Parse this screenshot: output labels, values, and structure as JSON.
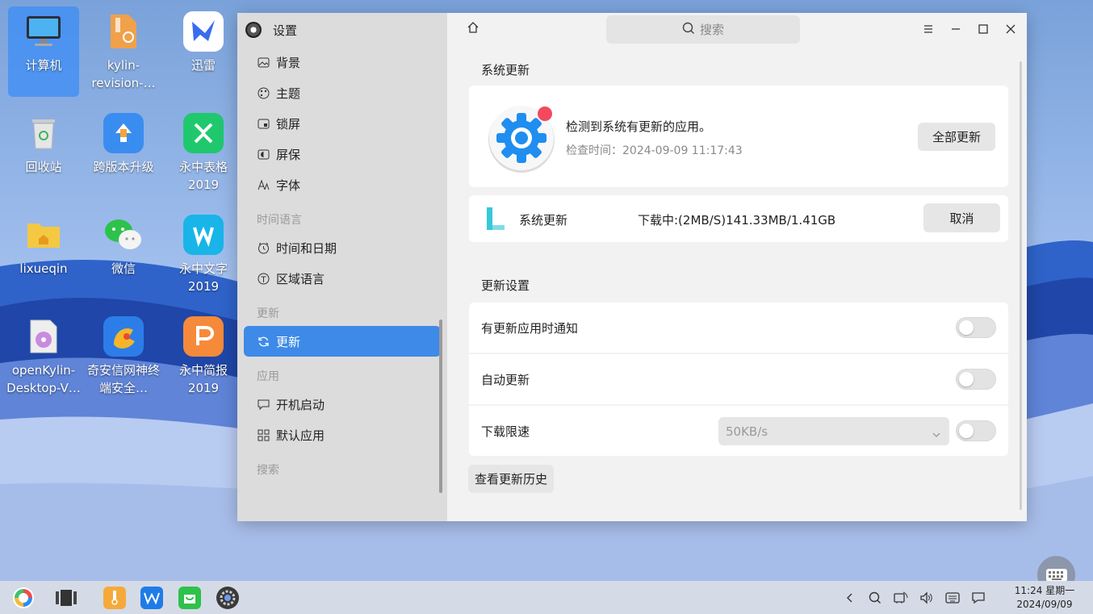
{
  "desktop": {
    "icons": [
      {
        "label": "计算机"
      },
      {
        "label": "kylin-revision-…"
      },
      {
        "label": "迅雷"
      },
      {
        "label": "回收站"
      },
      {
        "label": "跨版本升级"
      },
      {
        "label": "永中表格 2019"
      },
      {
        "label": "lixueqin"
      },
      {
        "label": "微信"
      },
      {
        "label": "永中文字 2019"
      },
      {
        "label": "openKylin-Desktop-V…"
      },
      {
        "label": "奇安信网神终端安全…"
      },
      {
        "label": "永中简报 2019"
      }
    ]
  },
  "settings": {
    "title": "设置",
    "sidebar": {
      "items_personal": [
        {
          "label": "背景",
          "icon": "image-icon"
        },
        {
          "label": "主题",
          "icon": "palette-icon"
        },
        {
          "label": "锁屏",
          "icon": "lockscreen-icon"
        },
        {
          "label": "屏保",
          "icon": "screensaver-icon"
        },
        {
          "label": "字体",
          "icon": "font-icon"
        }
      ],
      "group_time": "时间语言",
      "items_time": [
        {
          "label": "时间和日期",
          "icon": "clock-icon"
        },
        {
          "label": "区域语言",
          "icon": "region-icon"
        }
      ],
      "group_update": "更新",
      "items_update": [
        {
          "label": "更新",
          "icon": "refresh-icon",
          "active": true
        }
      ],
      "group_apps": "应用",
      "items_apps": [
        {
          "label": "开机启动",
          "icon": "autostart-icon"
        },
        {
          "label": "默认应用",
          "icon": "default-apps-icon"
        }
      ],
      "group_search": "搜索"
    },
    "search_placeholder": "搜索",
    "system_update": {
      "section_title": "系统更新",
      "status_text": "检测到系统有更新的应用。",
      "check_time": "检查时间：2024-09-09 11:17:43",
      "update_all_label": "全部更新",
      "item_name": "系统更新",
      "progress_text": "下载中:(2MB/S)141.33MB/1.41GB",
      "cancel_label": "取消"
    },
    "update_settings": {
      "section_title": "更新设置",
      "notify_label": "有更新应用时通知",
      "notify_on": false,
      "auto_update_label": "自动更新",
      "auto_update_on": false,
      "speed_limit_label": "下载限速",
      "speed_limit_value": "50KB/s",
      "speed_limit_on": false,
      "history_label": "查看更新历史"
    }
  },
  "taskbar": {
    "time": "11:24 星期一",
    "date": "2024/09/09"
  },
  "colors": {
    "accent": "#3d8ae8",
    "badge_red": "#f2495e"
  }
}
